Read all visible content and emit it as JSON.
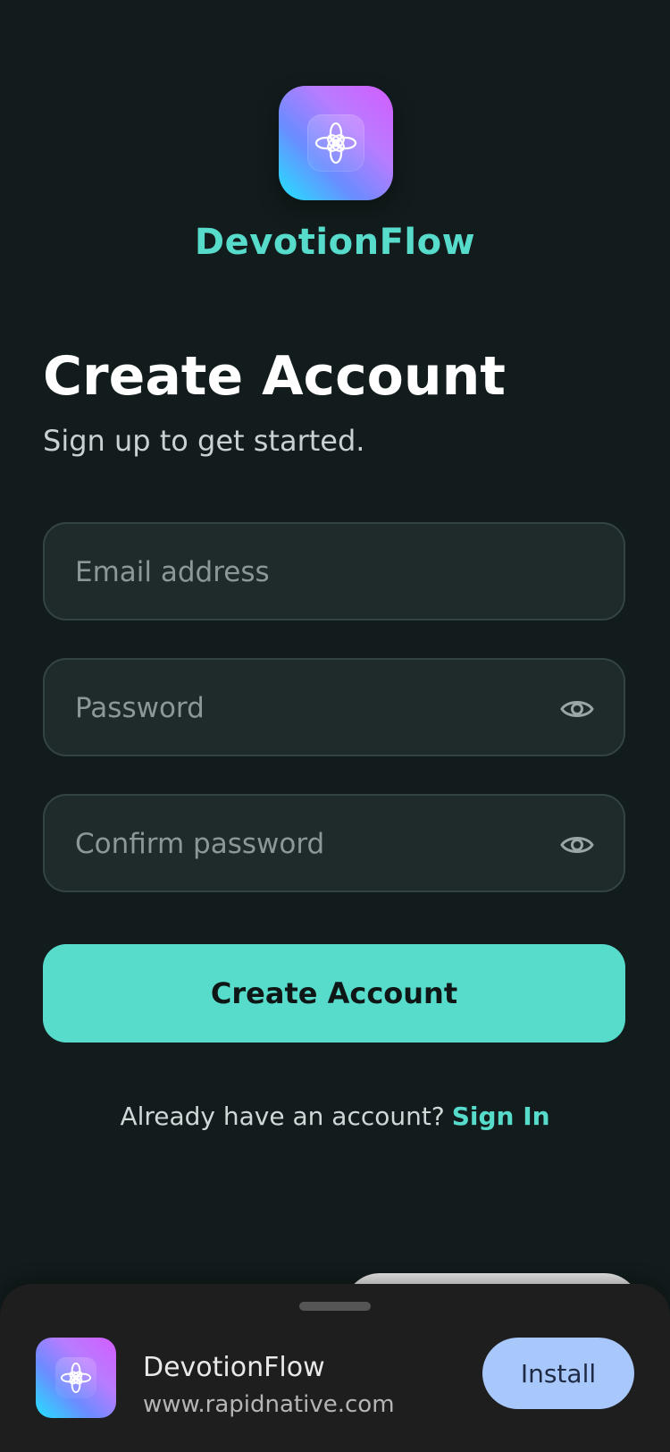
{
  "colors": {
    "accent": "#57dccc",
    "background": "#121c1c",
    "field": "#1f2a2a",
    "install_button": "#a8c7fa"
  },
  "app": {
    "icon": "lotus-icon",
    "name": "DevotionFlow"
  },
  "header": {
    "title": "Create Account",
    "subtitle": "Sign up to get started."
  },
  "form": {
    "email_placeholder": "Email address",
    "password_placeholder": "Password",
    "confirm_placeholder": "Confirm password",
    "submit_label": "Create Account"
  },
  "signin": {
    "prompt": "Already have an account?",
    "link_label": "Sign In"
  },
  "install_sheet": {
    "title": "DevotionFlow",
    "url": "www.rapidnative.com",
    "install_label": "Install"
  }
}
